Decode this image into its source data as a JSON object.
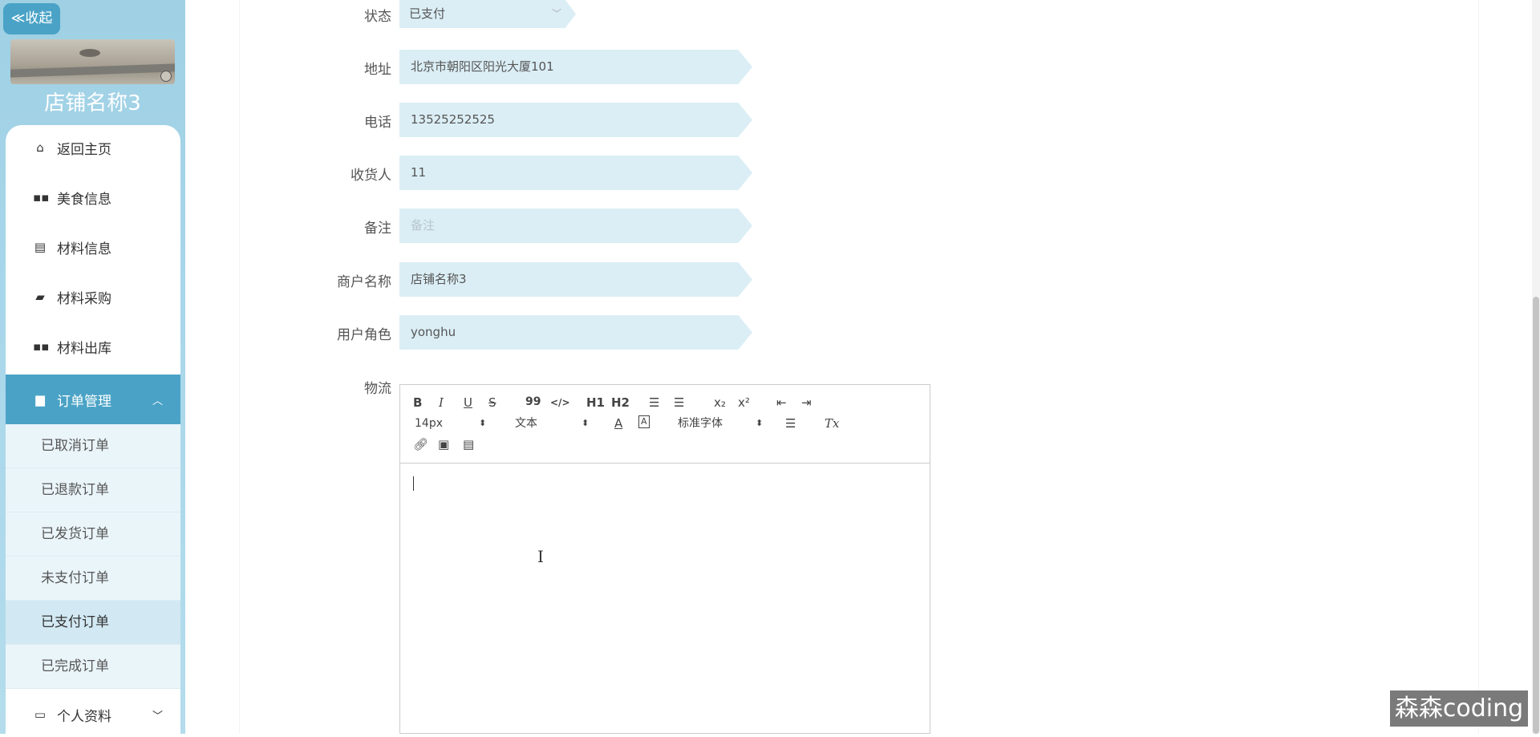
{
  "sidebar": {
    "collapse_label": "≪收起",
    "shop_name": "店铺名称3",
    "items": [
      {
        "label": "返回主页",
        "icon": "home-icon"
      },
      {
        "label": "美食信息",
        "icon": "grid-icon"
      },
      {
        "label": "材料信息",
        "icon": "clipboard-icon"
      },
      {
        "label": "材料采购",
        "icon": "purchase-icon"
      },
      {
        "label": "材料出库",
        "icon": "grid-icon"
      },
      {
        "label": "订单管理",
        "icon": "briefcase-icon"
      }
    ],
    "sub_items": [
      "已取消订单",
      "已退款订单",
      "已发货订单",
      "未支付订单",
      "已支付订单",
      "已完成订单"
    ],
    "selected_sub": "已支付订单",
    "profile": {
      "label": "个人资料",
      "icon": "profile-icon"
    }
  },
  "form": {
    "status": {
      "label": "状态",
      "value": "已支付"
    },
    "address": {
      "label": "地址",
      "value": "北京市朝阳区阳光大厦101"
    },
    "phone": {
      "label": "电话",
      "value": "13525252525"
    },
    "receiver": {
      "label": "收货人",
      "value": "11"
    },
    "remark": {
      "label": "备注",
      "placeholder": "备注"
    },
    "merchant": {
      "label": "商户名称",
      "value": "店铺名称3"
    },
    "role": {
      "label": "用户角色",
      "value": "yonghu"
    },
    "logistics": {
      "label": "物流"
    }
  },
  "editor": {
    "size": "14px",
    "format": "文本",
    "font": "标准字体",
    "buttons": {
      "bold": "B",
      "italic": "I",
      "underline": "U",
      "strike": "S",
      "quote": "99",
      "code": "</>",
      "h1": "H1",
      "h2": "H2",
      "sub": "x₂",
      "sup": "x²",
      "clean": "Tx"
    }
  },
  "watermark": "森森coding",
  "colors": {
    "accent": "#4aa3c6",
    "field_bg": "#dbeef5",
    "sidebar_bg": "#a8d6ea"
  }
}
